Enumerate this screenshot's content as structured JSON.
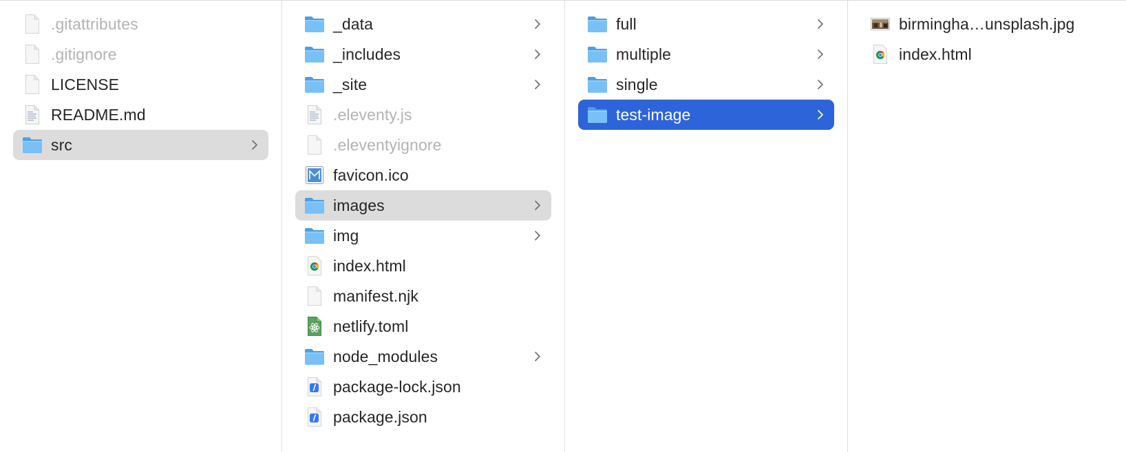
{
  "columns": [
    {
      "items": [
        {
          "name": ".gitattributes",
          "icon": "document-icon",
          "hidden": true
        },
        {
          "name": ".gitignore",
          "icon": "document-icon",
          "hidden": true
        },
        {
          "name": "LICENSE",
          "icon": "document-icon"
        },
        {
          "name": "README.md",
          "icon": "text-document-icon"
        },
        {
          "name": "src",
          "icon": "folder-icon",
          "folder": true,
          "selected": "gray"
        }
      ]
    },
    {
      "items": [
        {
          "name": "_data",
          "icon": "folder-icon",
          "folder": true
        },
        {
          "name": "_includes",
          "icon": "folder-icon",
          "folder": true
        },
        {
          "name": "_site",
          "icon": "folder-icon",
          "folder": true
        },
        {
          "name": ".eleventy.js",
          "icon": "text-document-icon",
          "hidden": true
        },
        {
          "name": ".eleventyignore",
          "icon": "document-icon",
          "hidden": true
        },
        {
          "name": "favicon.ico",
          "icon": "image-ico-icon"
        },
        {
          "name": "images",
          "icon": "folder-icon",
          "folder": true,
          "selected": "gray"
        },
        {
          "name": "img",
          "icon": "folder-icon",
          "folder": true
        },
        {
          "name": "index.html",
          "icon": "chrome-html-icon"
        },
        {
          "name": "manifest.njk",
          "icon": "document-icon"
        },
        {
          "name": "netlify.toml",
          "icon": "atom-file-icon"
        },
        {
          "name": "node_modules",
          "icon": "folder-icon",
          "folder": true
        },
        {
          "name": "package-lock.json",
          "icon": "json-file-icon"
        },
        {
          "name": "package.json",
          "icon": "json-file-icon"
        }
      ]
    },
    {
      "items": [
        {
          "name": "full",
          "icon": "folder-icon",
          "folder": true
        },
        {
          "name": "multiple",
          "icon": "folder-icon",
          "folder": true
        },
        {
          "name": "single",
          "icon": "folder-icon",
          "folder": true
        },
        {
          "name": "test-image",
          "icon": "folder-icon",
          "folder": true,
          "selected": "blue"
        }
      ]
    },
    {
      "items": [
        {
          "name": "birmingha…unsplash.jpg",
          "icon": "photo-thumbnail-icon"
        },
        {
          "name": "index.html",
          "icon": "chrome-html-icon"
        }
      ]
    }
  ],
  "colors": {
    "selection_blue": "#2d64da",
    "selection_gray": "#dcdcdc",
    "folder": "#5fb2f0",
    "hidden_text": "#b3b3b3"
  }
}
